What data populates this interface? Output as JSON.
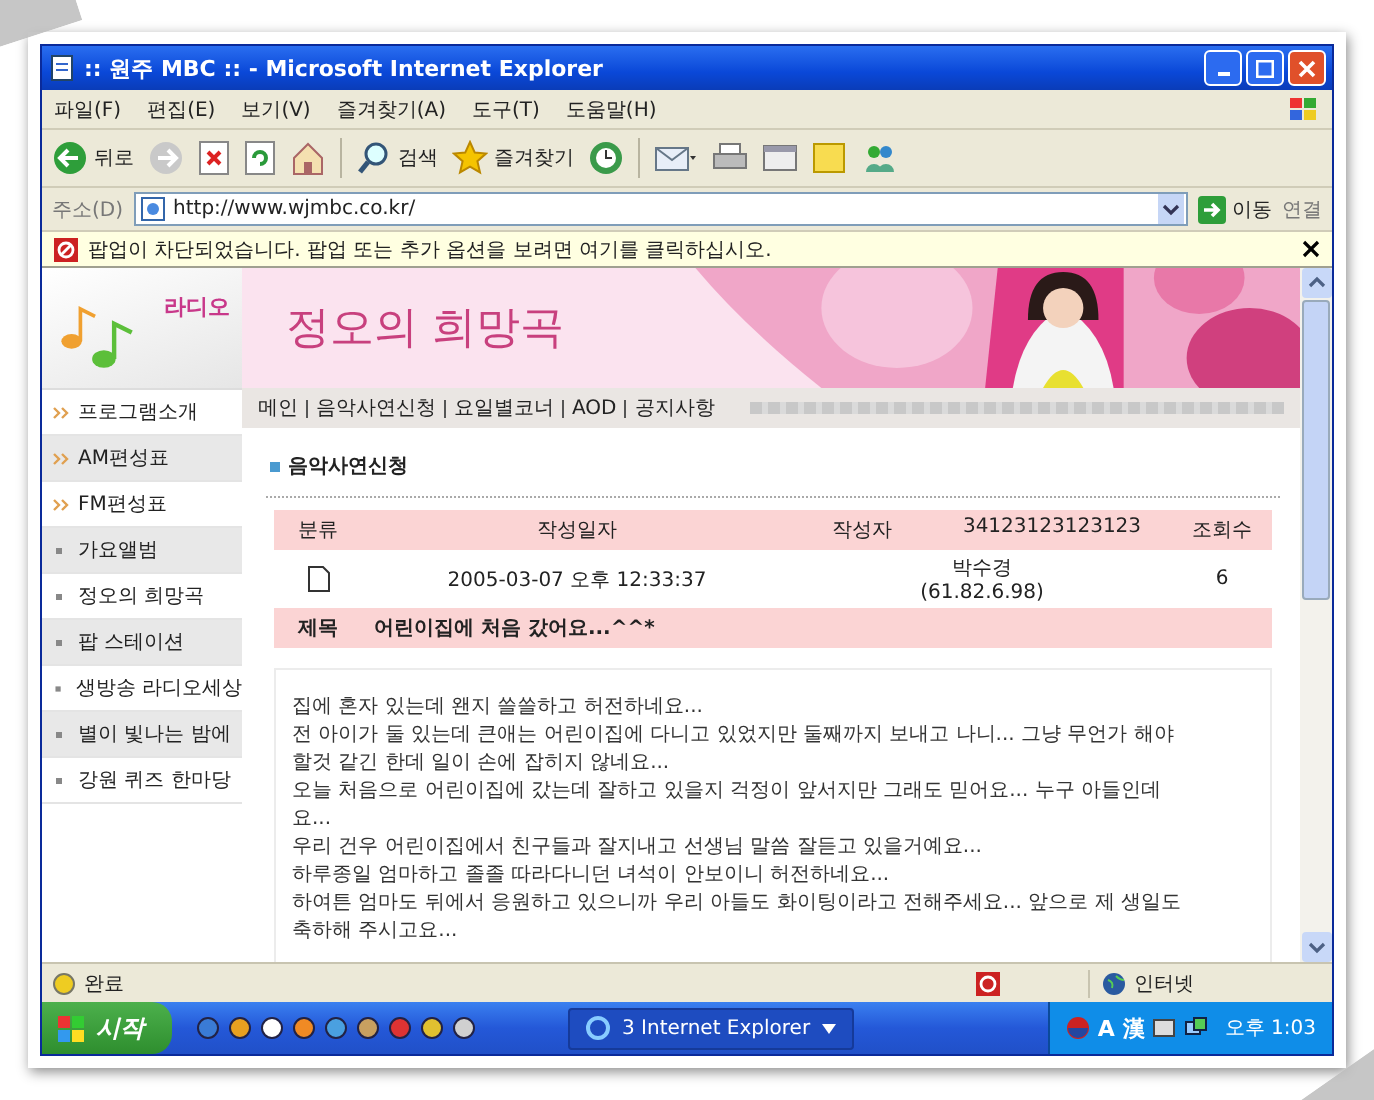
{
  "window": {
    "title": ":: 원주 MBC :: - Microsoft Internet Explorer"
  },
  "menu": [
    "파일(F)",
    "편집(E)",
    "보기(V)",
    "즐겨찾기(A)",
    "도구(T)",
    "도움말(H)"
  ],
  "toolbar": {
    "back": "뒤로",
    "search": "검색",
    "favorites": "즐겨찾기"
  },
  "address": {
    "label": "주소(D)",
    "value": "http://www.wjmbc.co.kr/",
    "go": "이동",
    "links": "연결"
  },
  "infobar": "팝업이 차단되었습니다. 팝업 또는 추가 옵션을 보려면 여기를 클릭하십시오.",
  "page": {
    "logo": "라디오",
    "banner_title": "정오의 희망곡",
    "sidebar": [
      {
        "label": "프로그램소개",
        "kind": "arrow"
      },
      {
        "label": "AM편성표",
        "kind": "arrow"
      },
      {
        "label": "FM편성표",
        "kind": "arrow"
      },
      {
        "label": "가요앨범",
        "kind": "bullet"
      },
      {
        "label": "정오의 희망곡",
        "kind": "bullet"
      },
      {
        "label": "팝 스테이션",
        "kind": "bullet"
      },
      {
        "label": "생방송 라디오세상",
        "kind": "bullet"
      },
      {
        "label": "별이 빛나는 밤에",
        "kind": "bullet"
      },
      {
        "label": "강원 퀴즈 한마당",
        "kind": "bullet"
      }
    ],
    "nav": [
      "메인",
      "음악사연신청",
      "요일별코너",
      "AOD",
      "공지사항"
    ],
    "section_title": "음악사연신청",
    "table": {
      "columns": [
        "분류",
        "작성일자",
        "작성자",
        "34123123123123",
        "조회수"
      ],
      "row": {
        "date": "2005-03-07 오후 12:33:37",
        "author": "박수경",
        "author_ip": "(61.82.6.98)",
        "views": "6"
      },
      "subject_label": "제목",
      "subject": "어린이집에 처음 갔어요...^^*"
    },
    "body": [
      "집에 혼자 있는데 왠지 쓸쓸하고 허전하네요...",
      "전 아이가 둘 있는데 큰애는 어린이집에 다니고 있었지만 둘째까지 보내고 나니... 그냥 무언가 해야",
      "할것 같긴 한데 일이 손에 잡히지 않네요...",
      "오늘 처음으로 어린이집에 갔는데 잘하고 있을지 걱정이 앞서지만 그래도 믿어요... 누구 아들인데",
      "요...",
      "우리 건우 어린이집에서 친구들과 잘지내고 선생님 말씀 잘듣고 있을거예요...",
      "하루종일 엄마하고 졸졸 따라다니던 녀석이 안보이니 허전하네요...",
      "하여튼 엄마도 뒤에서 응원하고 있으니까 우리 아들도 화이팅이라고 전해주세요... 앞으로 제 생일도",
      "축하해 주시고요..."
    ]
  },
  "status_bar": {
    "text": "완료",
    "zone": "인터넷"
  },
  "taskbar": {
    "start": "시작",
    "task": "3 Internet Explorer",
    "tray": [
      "A",
      "漢"
    ],
    "clock": "오후 1:03"
  }
}
